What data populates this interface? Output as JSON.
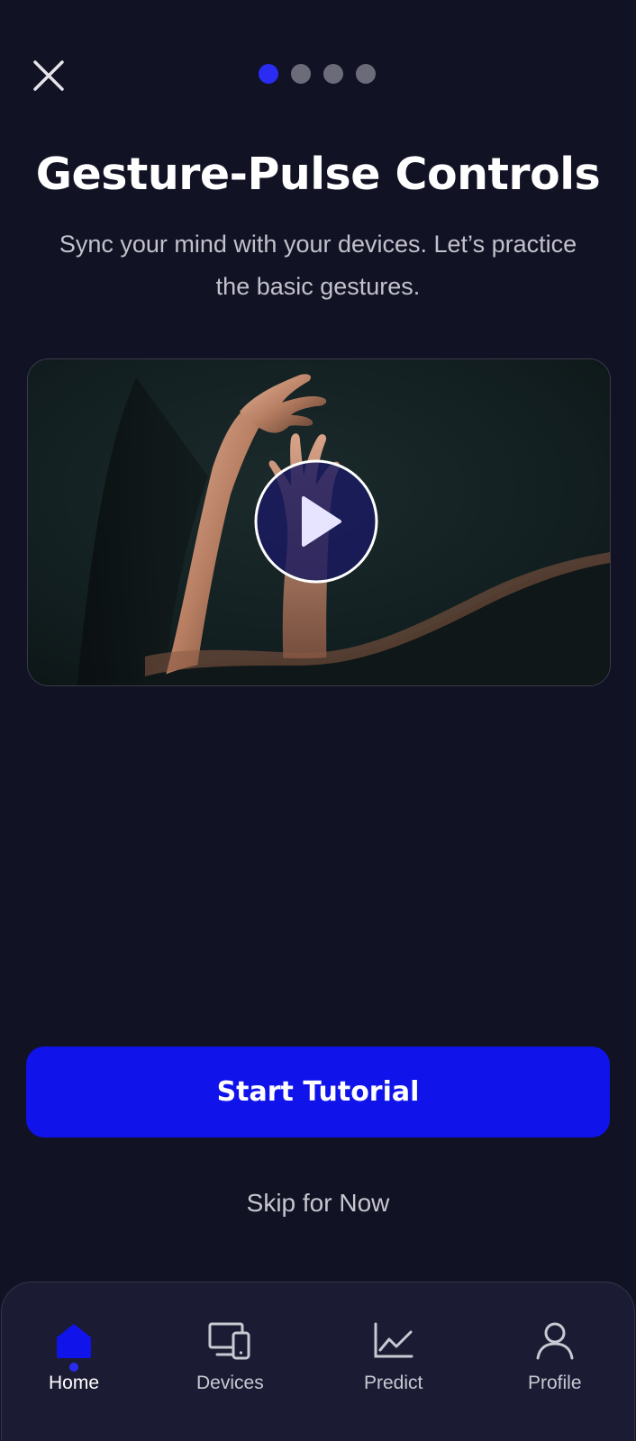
{
  "header": {
    "close_icon": "close-icon",
    "pagination": {
      "total": 4,
      "current": 1
    },
    "colors": {
      "active_dot": "#2a2cf2",
      "inactive_dot": "#6b6b7a"
    }
  },
  "content": {
    "title": "Gesture-Pulse Controls",
    "subtitle": "Sync your mind with your devices. Let’s practice the basic gestures.",
    "video": {
      "play_icon": "play-icon"
    }
  },
  "actions": {
    "primary_label": "Start Tutorial",
    "skip_label": "Skip for Now"
  },
  "tabbar": {
    "items": [
      {
        "label": "Home",
        "icon": "home-icon",
        "active": true
      },
      {
        "label": "Devices",
        "icon": "devices-icon",
        "active": false
      },
      {
        "label": "Predict",
        "icon": "chart-icon",
        "active": false
      },
      {
        "label": "Profile",
        "icon": "user-icon",
        "active": false
      }
    ]
  },
  "colors": {
    "background": "#121225",
    "accent": "#1014ea",
    "tabbar_bg": "#1b1b34"
  }
}
